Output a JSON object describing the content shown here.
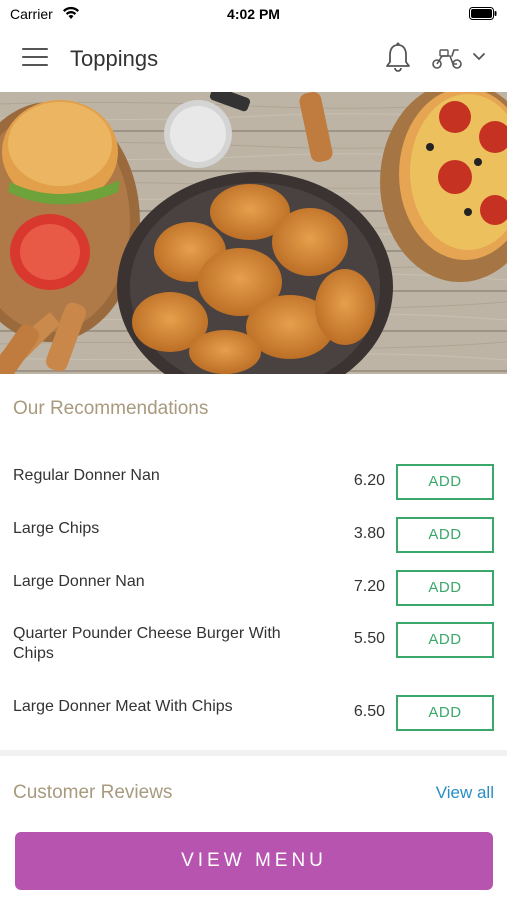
{
  "status_bar": {
    "carrier": "Carrier",
    "time": "4:02 PM"
  },
  "header": {
    "title": "Toppings"
  },
  "hero": {
    "icon": "food-photo"
  },
  "recommendations": {
    "title": "Our Recommendations",
    "items": [
      {
        "name": "Regular Donner Nan",
        "price": "6.20",
        "button": "ADD"
      },
      {
        "name": "Large Chips",
        "price": "3.80",
        "button": "ADD"
      },
      {
        "name": "Large Donner Nan",
        "price": "7.20",
        "button": "ADD"
      },
      {
        "name": "Quarter Pounder Cheese Burger With Chips",
        "price": "5.50",
        "button": "ADD"
      },
      {
        "name": "Large Donner Meat With Chips",
        "price": "6.50",
        "button": "ADD"
      }
    ]
  },
  "reviews": {
    "title": "Customer Reviews",
    "view_all": "View all"
  },
  "footer": {
    "view_menu": "VIEW MENU"
  },
  "colors": {
    "accent": "#b654b0",
    "add_green": "#3aa86a",
    "section_title": "#a89a7e",
    "link": "#2a8dc5"
  }
}
